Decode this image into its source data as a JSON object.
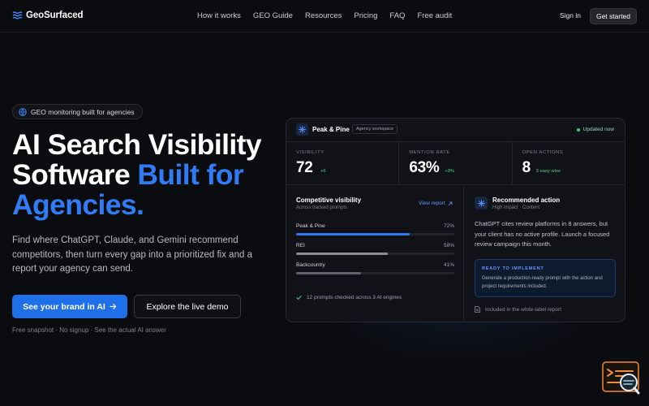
{
  "nav": {
    "brand": "GeoSurfaced",
    "links": [
      "How it works",
      "GEO Guide",
      "Resources",
      "Pricing",
      "FAQ",
      "Free audit"
    ],
    "signin": "Sign in",
    "get_started": "Get started"
  },
  "hero": {
    "badge": "GEO monitoring built for agencies",
    "headline_part1": "AI Search Visibility Software",
    "headline_part2": "Built for Agencies.",
    "subtext": "Find where ChatGPT, Claude, and Gemini recommend competitors, then turn every gap into a prioritized fix and a report your agency can send.",
    "cta_primary": "See your brand in AI",
    "cta_secondary": "Explore the live demo",
    "fine_print": "Free snapshot · No signup · See the actual AI answer"
  },
  "dashboard": {
    "workspace_name": "Peak & Pine",
    "workspace_tag": "Agency workspace",
    "status": "Updated now",
    "stats": [
      {
        "label": "VISIBILITY",
        "value": "72",
        "delta": "+6"
      },
      {
        "label": "MENTION RATE",
        "value": "63%",
        "delta": "+9%"
      },
      {
        "label": "OPEN ACTIONS",
        "value": "8",
        "delta": "3 easy wins"
      }
    ],
    "competitive": {
      "title": "Competitive visibility",
      "subtitle": "Across tracked prompts",
      "link": "View report",
      "bars": [
        {
          "label": "Peak & Pine",
          "pct_text": "72%",
          "value": 72,
          "color": "#2f7cf6"
        },
        {
          "label": "REI",
          "pct_text": "58%",
          "value": 58,
          "color": "#8a8f99"
        },
        {
          "label": "Backcountry",
          "pct_text": "41%",
          "value": 41,
          "color": "#5d626c"
        }
      ],
      "footer": "12 prompts checked across 3 AI engines"
    },
    "recommended": {
      "title": "Recommended action",
      "subtitle": "High impact · Content",
      "text": "ChatGPT cites review platforms in 8 answers, but your client has no active profile. Launch a focused review campaign this month.",
      "ready_title": "READY TO IMPLEMENT",
      "ready_text": "Generate a production-ready prompt with the action and project requirements included.",
      "footer": "Included in the white-label report"
    }
  },
  "colors": {
    "accent": "#2f7cf6",
    "background": "#0b0c0f",
    "positive": "#4fd28a"
  }
}
